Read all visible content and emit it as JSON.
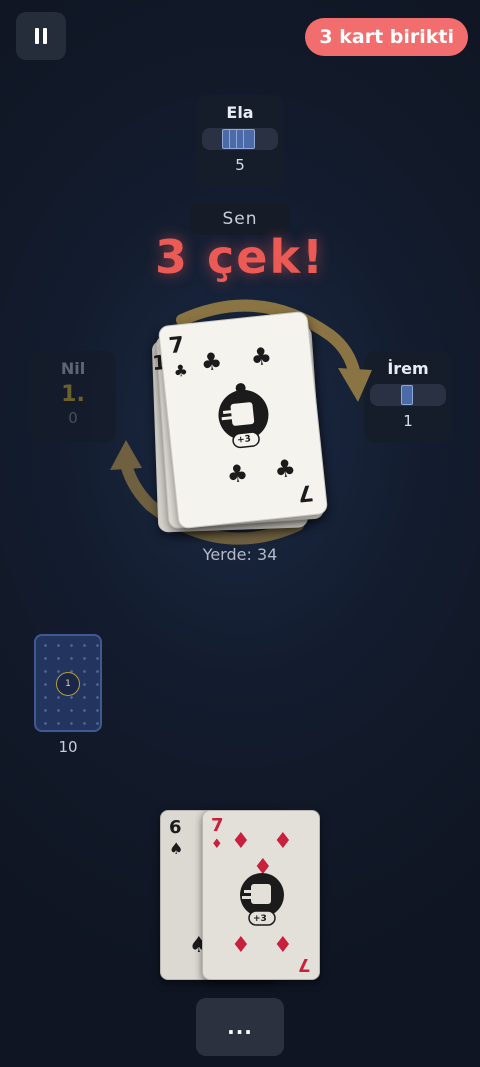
{
  "hud": {
    "pause_icon": "pause-icon",
    "accumulated_badge": "3 kart birikti",
    "accent": "#f26d6d"
  },
  "players": {
    "top": {
      "name": "Ela",
      "count": "5"
    },
    "right": {
      "name": "İrem",
      "count": "1"
    },
    "left": {
      "name": "Nil",
      "rank": "1.",
      "count": "0"
    }
  },
  "turn": {
    "label": "Sen",
    "penalty_text": "3 çek!"
  },
  "discard_pile": {
    "under_rank": "1",
    "top_card": {
      "rank": "7",
      "suit": "clubs",
      "suit_symbol": "♣",
      "badge": "+3"
    },
    "ground_label": "Yerde: 34"
  },
  "draw_deck": {
    "marker": "1",
    "count": "10"
  },
  "hand": [
    {
      "rank": "6",
      "suit": "spades",
      "suit_symbol": "♠"
    },
    {
      "rank": "7",
      "suit": "diamonds",
      "suit_symbol": "♦",
      "badge": "+3"
    }
  ],
  "menu": {
    "label": "..."
  }
}
